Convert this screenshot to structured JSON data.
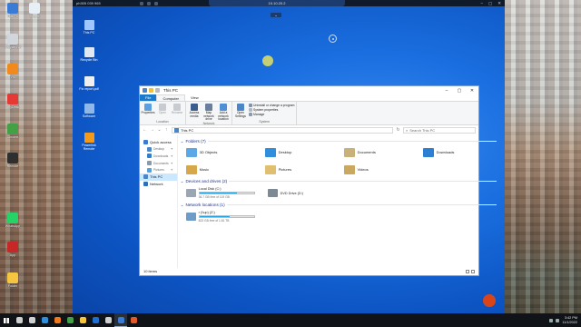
{
  "host": {
    "icons": [
      {
        "label": "This PC",
        "color": "#3a7bd5"
      },
      {
        "label": "Skype",
        "color": "#e8eef5"
      },
      {
        "label": "Recycle Bin",
        "color": "#d0d6dc"
      },
      {
        "label": "Vlc",
        "color": "#f18a1c"
      },
      {
        "label": "AnyDesk",
        "color": "#e53935"
      },
      {
        "label": "Chrome",
        "color": "#43a047"
      },
      {
        "label": "Remote",
        "color": "#2f2f2f"
      },
      {
        "label": "WhatsApp",
        "color": "#25d366"
      },
      {
        "label": "App",
        "color": "#c62828"
      },
      {
        "label": "Folder",
        "color": "#f5c542"
      }
    ]
  },
  "remote": {
    "session_title": "ph305 039 965",
    "center_title": "10.10.20.2",
    "tab_label": "⌄",
    "desktop_icons": [
      {
        "label": "This PC",
        "color": "#9fc6ff"
      },
      {
        "label": "Recycle Bin",
        "color": "#dfe8f3"
      },
      {
        "label": "Fix report.pdf",
        "color": "#f0f0f0"
      },
      {
        "label": "Software",
        "color": "#8fb8e8"
      },
      {
        "label": "Powerlink Remote",
        "color": "#f49a1a"
      }
    ]
  },
  "explorer": {
    "window_title": "This PC",
    "ribbon_tabs": [
      "File",
      "Computer",
      "View"
    ],
    "location_buttons": [
      {
        "label": "Properties",
        "dim": false,
        "color": "#5aa0e0"
      },
      {
        "label": "Open",
        "dim": true,
        "color": "#c8ccd0"
      },
      {
        "label": "Rename",
        "dim": true,
        "color": "#c8ccd0"
      }
    ],
    "network_buttons": [
      {
        "label": "Access media",
        "dim": false,
        "color": "#3d5e8c"
      },
      {
        "label": "Map network drive",
        "dim": false,
        "color": "#6a7f9c"
      },
      {
        "label": "Add a network location",
        "dim": false,
        "color": "#4e8fd6"
      }
    ],
    "system_open_label": "Open Settings",
    "system_items": [
      {
        "label": "Uninstall or change a program",
        "color": "#7d93b0"
      },
      {
        "label": "System properties",
        "color": "#b0b8c0"
      },
      {
        "label": "Manage",
        "color": "#8a9aa8"
      }
    ],
    "group_names": {
      "location": "Location",
      "network": "Network",
      "system": "System"
    },
    "address": "This PC",
    "search_placeholder": "Search This PC",
    "nav": {
      "quick_access": "Quick access",
      "pinned": [
        {
          "label": "Desktop",
          "color": "#4a86c8"
        },
        {
          "label": "Downloads",
          "color": "#2f7fd0"
        },
        {
          "label": "Documents",
          "color": "#8a9aa8"
        },
        {
          "label": "Pictures",
          "color": "#58a0d8"
        }
      ],
      "this_pc": "This PC",
      "network": "Network"
    },
    "folders_header": "Folders (7)",
    "folders": [
      {
        "label": "3D Objects",
        "color": "#5aa9e6"
      },
      {
        "label": "Desktop",
        "color": "#2f8fdc"
      },
      {
        "label": "Documents",
        "color": "#c9b27a"
      },
      {
        "label": "Downloads",
        "color": "#2c7fd2"
      },
      {
        "label": "Music",
        "color": "#d6a84a"
      },
      {
        "label": "Pictures",
        "color": "#e0c070"
      },
      {
        "label": "Videos",
        "color": "#caa860"
      }
    ],
    "devices_header": "Devices and drives (2)",
    "local_disk": {
      "name": "Local Disk (C:)",
      "free": "36.7 GB free of 119 GB",
      "used_fraction": 0.69
    },
    "dvd": {
      "name": "DVD Drive (D:)"
    },
    "network_header": "Network locations (1)",
    "net_drive": {
      "name": "r (\\\\up) (Z:)",
      "free": "823 GB free of 1.81 TB",
      "used_fraction": 0.56
    },
    "status": "10 items"
  },
  "taskbar": {
    "items": [
      {
        "name": "search",
        "color": "#d0d0d0"
      },
      {
        "name": "task-view",
        "color": "#d0d0d0"
      },
      {
        "name": "edge",
        "color": "#2f8fdc"
      },
      {
        "name": "firefox",
        "color": "#f0791c"
      },
      {
        "name": "chrome",
        "color": "#43a047"
      },
      {
        "name": "explorer",
        "color": "#f5c542"
      },
      {
        "name": "teamviewer",
        "color": "#1e6fd0"
      },
      {
        "name": "settings",
        "color": "#cfcfcf"
      },
      {
        "name": "remote",
        "color": "#3a7bd5"
      },
      {
        "name": "app",
        "color": "#e05a2b"
      }
    ],
    "time": "3:42 PM",
    "date": "11/1/2022"
  }
}
